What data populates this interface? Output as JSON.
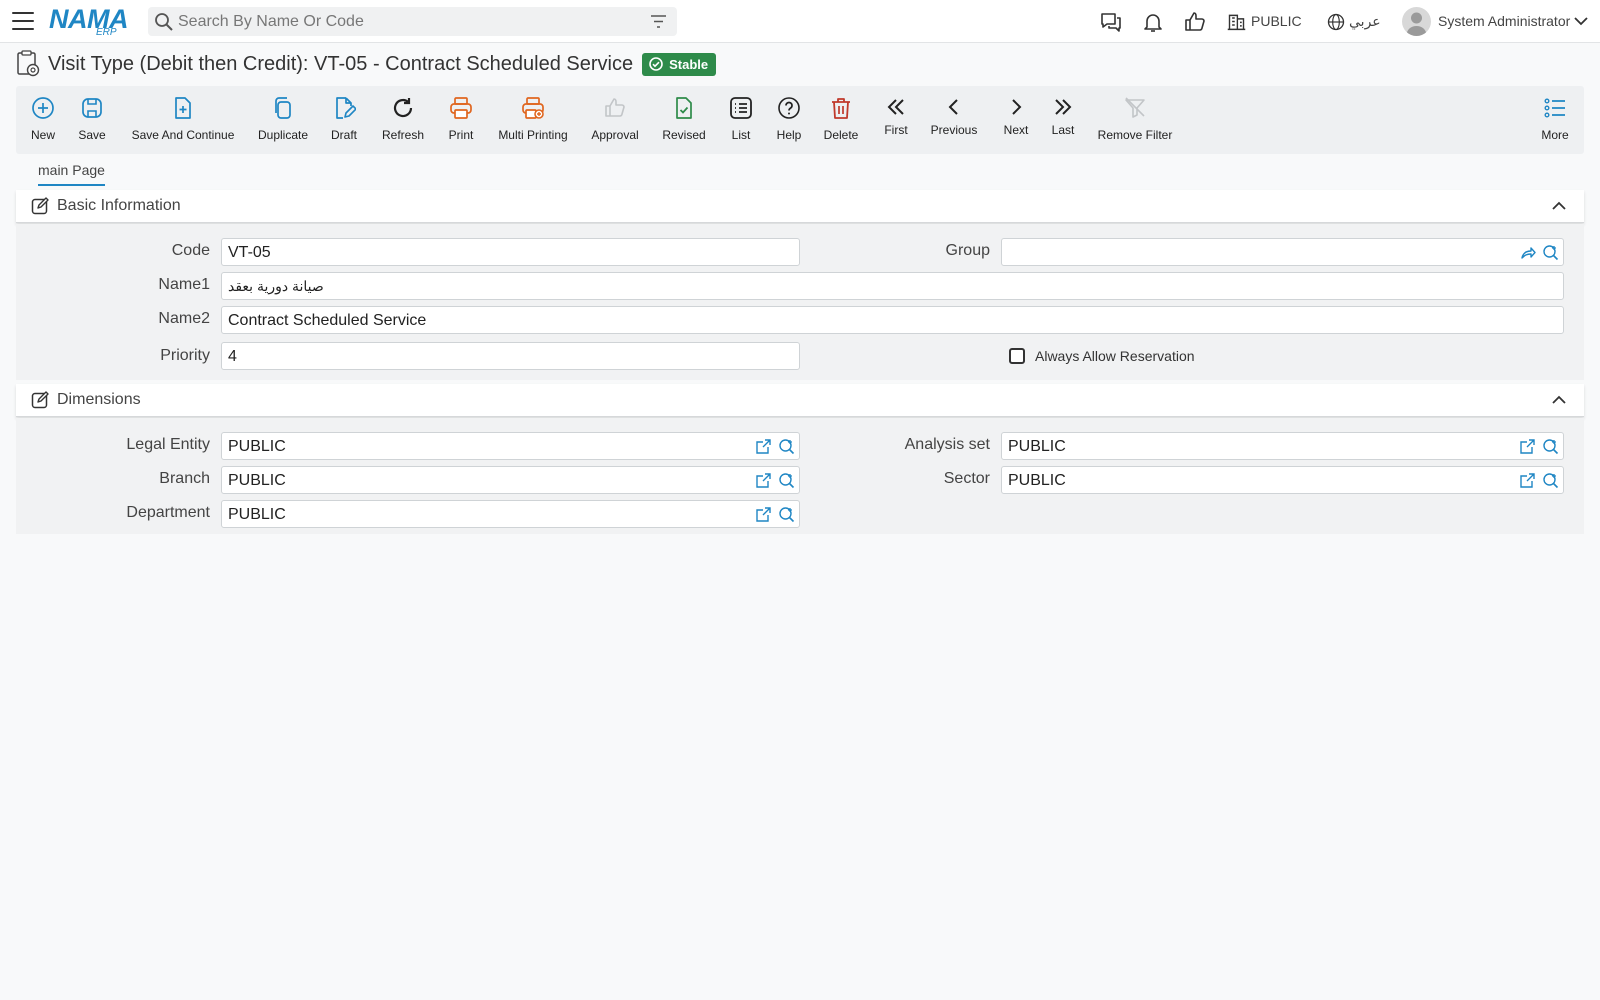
{
  "header": {
    "logo_text": "NAMA",
    "logo_sub": "ERP",
    "search_placeholder": "Search By Name Or Code",
    "org_label": "PUBLIC",
    "language_label": "عربي",
    "user_name": "System Administrator"
  },
  "page": {
    "title": "Visit Type (Debit then Credit): VT-05 - Contract Scheduled Service",
    "status_badge": "Stable"
  },
  "toolbar": {
    "new": "New",
    "save": "Save",
    "save_continue": "Save And Continue",
    "duplicate": "Duplicate",
    "draft": "Draft",
    "refresh": "Refresh",
    "print": "Print",
    "multi_printing": "Multi Printing",
    "approval": "Approval",
    "revised": "Revised",
    "list": "List",
    "help": "Help",
    "delete": "Delete",
    "first": "First",
    "previous": "Previous",
    "next": "Next",
    "last": "Last",
    "remove_filter": "Remove Filter",
    "more": "More"
  },
  "tabs": {
    "main": "main Page"
  },
  "basic_info": {
    "title": "Basic Information",
    "code_label": "Code",
    "code_value": "VT-05",
    "group_label": "Group",
    "group_value": "",
    "name1_label": "Name1",
    "name1_value": "صيانة دورية بعقد",
    "name2_label": "Name2",
    "name2_value": "Contract Scheduled Service",
    "priority_label": "Priority",
    "priority_value": "4",
    "always_allow_label": "Always Allow Reservation"
  },
  "dimensions": {
    "title": "Dimensions",
    "legal_entity_label": "Legal Entity",
    "legal_entity_value": "PUBLIC",
    "analysis_set_label": "Analysis set",
    "analysis_set_value": "PUBLIC",
    "branch_label": "Branch",
    "branch_value": "PUBLIC",
    "sector_label": "Sector",
    "sector_value": "PUBLIC",
    "department_label": "Department",
    "department_value": "PUBLIC"
  },
  "colors": {
    "accent": "#1f86c4",
    "print_orange": "#e0661f",
    "revised_green": "#2e8b4a",
    "delete_red": "#c0392b",
    "badge_green": "#2e8b4a"
  }
}
